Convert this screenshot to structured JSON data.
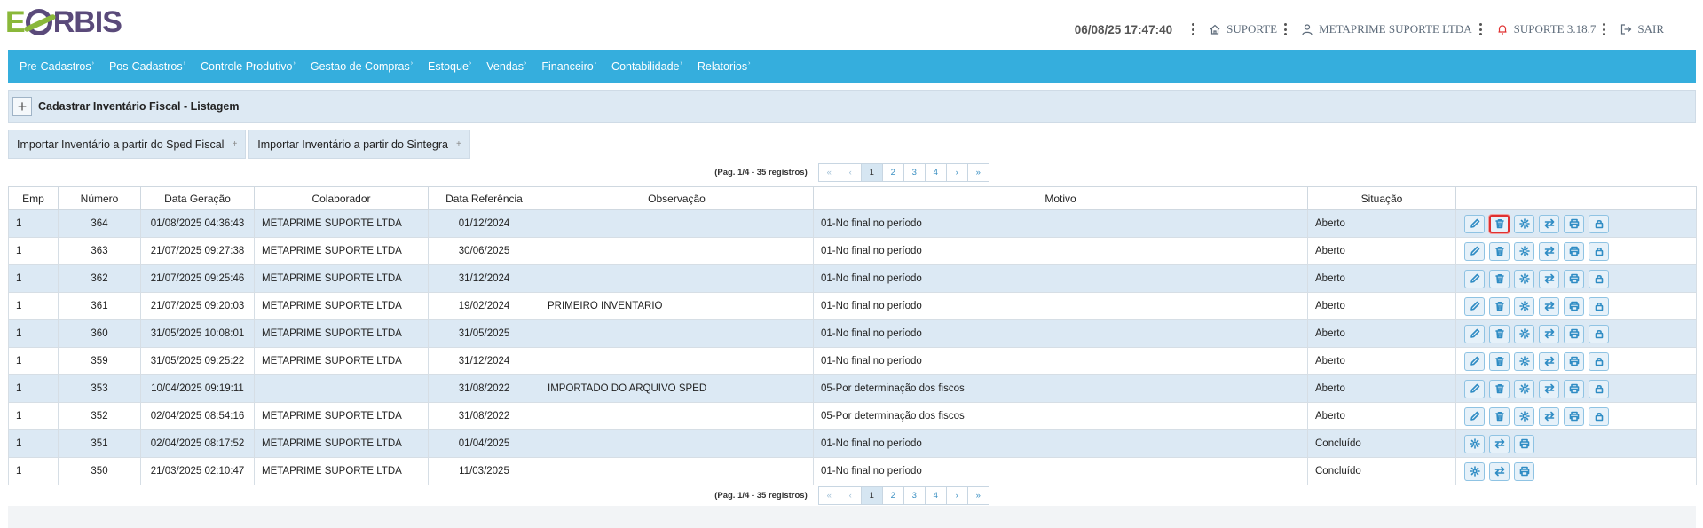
{
  "header": {
    "logo_text": "EORBIS",
    "datetime": "06/08/25 17:47:40",
    "location": "SUPORTE",
    "company": "METAPRIME SUPORTE LTDA",
    "version": "SUPORTE 3.18.7",
    "exit": "SAIR",
    "colors": {
      "logo_purple": "#5a4a7a",
      "logo_green": "#8ab83a",
      "alert_icon": "#e03030"
    }
  },
  "menu": {
    "items": [
      {
        "label": "Pre-Cadastros"
      },
      {
        "label": "Pos-Cadastros"
      },
      {
        "label": "Controle Produtivo"
      },
      {
        "label": "Gestao de Compras"
      },
      {
        "label": "Estoque"
      },
      {
        "label": "Vendas"
      },
      {
        "label": "Financeiro"
      },
      {
        "label": "Contabilidade"
      },
      {
        "label": "Relatorios"
      }
    ],
    "color": "#35aedd"
  },
  "form": {
    "title": "Cadastrar Inventário Fiscal - Listagem",
    "import_sped": "Importar Inventário a partir do Sped Fiscal",
    "import_sintegra": "Importar Inventário a partir do Sintegra"
  },
  "pager": {
    "info": "(Pag. 1/4 - 35 registros)",
    "first": "«",
    "prev": "‹",
    "next": "›",
    "last": "»",
    "pages": [
      "1",
      "2",
      "3",
      "4"
    ],
    "current": "1"
  },
  "table": {
    "columns": [
      "Emp",
      "Número",
      "Data Geração",
      "Colaborador",
      "Data Referência",
      "Observação",
      "Motivo",
      "Situação",
      ""
    ],
    "rows": [
      {
        "emp": "1",
        "numero": "364",
        "geracao": "01/08/2025 04:36:43",
        "colaborador": "METAPRIME SUPORTE LTDA",
        "referencia": "01/12/2024",
        "observacao": "",
        "motivo": "01-No final no período",
        "situacao": "Aberto"
      },
      {
        "emp": "1",
        "numero": "363",
        "geracao": "21/07/2025 09:27:38",
        "colaborador": "METAPRIME SUPORTE LTDA",
        "referencia": "30/06/2025",
        "observacao": "",
        "motivo": "01-No final no período",
        "situacao": "Aberto"
      },
      {
        "emp": "1",
        "numero": "362",
        "geracao": "21/07/2025 09:25:46",
        "colaborador": "METAPRIME SUPORTE LTDA",
        "referencia": "31/12/2024",
        "observacao": "",
        "motivo": "01-No final no período",
        "situacao": "Aberto"
      },
      {
        "emp": "1",
        "numero": "361",
        "geracao": "21/07/2025 09:20:03",
        "colaborador": "METAPRIME SUPORTE LTDA",
        "referencia": "19/02/2024",
        "observacao": "PRIMEIRO INVENTARIO",
        "motivo": "01-No final no período",
        "situacao": "Aberto"
      },
      {
        "emp": "1",
        "numero": "360",
        "geracao": "31/05/2025 10:08:01",
        "colaborador": "METAPRIME SUPORTE LTDA",
        "referencia": "31/05/2025",
        "observacao": "",
        "motivo": "01-No final no período",
        "situacao": "Aberto"
      },
      {
        "emp": "1",
        "numero": "359",
        "geracao": "31/05/2025 09:25:22",
        "colaborador": "METAPRIME SUPORTE LTDA",
        "referencia": "31/12/2024",
        "observacao": "",
        "motivo": "01-No final no período",
        "situacao": "Aberto"
      },
      {
        "emp": "1",
        "numero": "353",
        "geracao": "10/04/2025 09:19:11",
        "colaborador": "",
        "referencia": "31/08/2022",
        "observacao": "IMPORTADO DO ARQUIVO SPED",
        "motivo": "05-Por determinação dos fiscos",
        "situacao": "Aberto"
      },
      {
        "emp": "1",
        "numero": "352",
        "geracao": "02/04/2025 08:54:16",
        "colaborador": "METAPRIME SUPORTE LTDA",
        "referencia": "31/08/2022",
        "observacao": "",
        "motivo": "05-Por determinação dos fiscos",
        "situacao": "Aberto"
      },
      {
        "emp": "1",
        "numero": "351",
        "geracao": "02/04/2025 08:17:52",
        "colaborador": "METAPRIME SUPORTE LTDA",
        "referencia": "01/04/2025",
        "observacao": "",
        "motivo": "01-No final no período",
        "situacao": "Concluído"
      },
      {
        "emp": "1",
        "numero": "350",
        "geracao": "21/03/2025 02:10:47",
        "colaborador": "METAPRIME SUPORTE LTDA",
        "referencia": "11/03/2025",
        "observacao": "",
        "motivo": "01-No final no período",
        "situacao": "Concluído"
      }
    ],
    "row_colors": {
      "odd": "#dce9f4",
      "even": "#ffffff"
    }
  }
}
